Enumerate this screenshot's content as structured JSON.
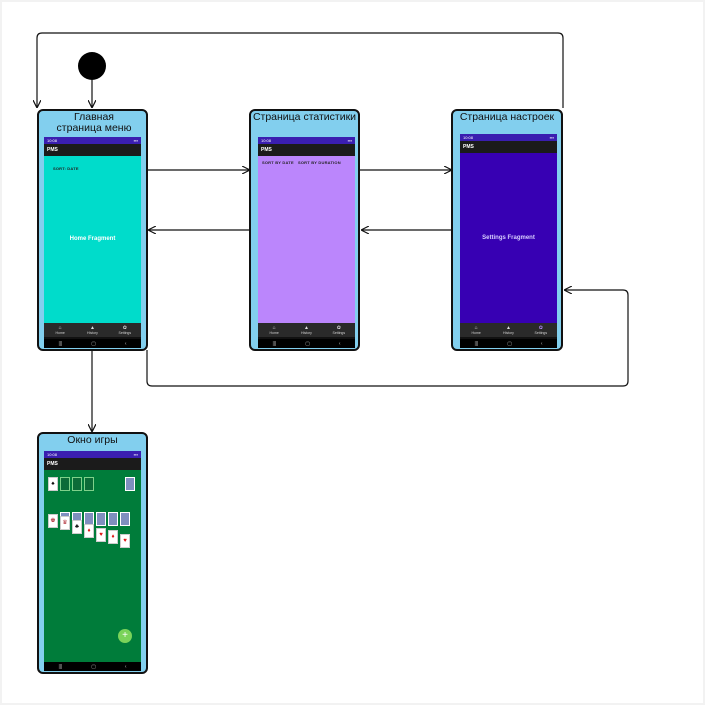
{
  "nodes": {
    "home": {
      "title": "Главная страница меню",
      "app_title": "PMS",
      "status_time": "10:08",
      "sort_label": "SORT: DATE",
      "fragment_label": "Home Fragment",
      "bg_color": "#00dccb"
    },
    "stats": {
      "title": "Страница статистики",
      "app_title": "PMS",
      "status_time": "10:08",
      "sort_by_date": "SORT BY DATE",
      "sort_by_duration": "SORT BY DURATION",
      "bg_color": "#bb86fc"
    },
    "settings": {
      "title": "Страница настроек",
      "app_title": "PMS",
      "status_time": "10:08",
      "fragment_label": "Settings Fragment",
      "bg_color": "#3700b3"
    },
    "game": {
      "title": "Окно игры",
      "app_title": "PMS",
      "status_time": "10:08",
      "bg_color": "#007c3a",
      "fab_symbol": "+"
    }
  },
  "bottom_nav": [
    {
      "label": "Home",
      "icon": "home-icon",
      "glyph": "⌂"
    },
    {
      "label": "History",
      "icon": "history-icon",
      "glyph": "▲"
    },
    {
      "label": "Settings",
      "icon": "gear-icon",
      "glyph": "✿"
    }
  ],
  "system_nav": [
    "|||",
    "▢",
    "‹"
  ],
  "colors": {
    "node_fill": "#82cfee",
    "edge": "#111111",
    "start_node": "#000000"
  }
}
